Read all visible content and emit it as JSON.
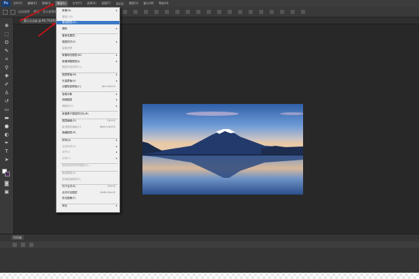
{
  "app": {
    "logo_text": "Ps"
  },
  "menubar": {
    "items": [
      "文件(F)",
      "编辑(E)",
      "图像(I)",
      "图层(L)",
      "文字(Y)",
      "选择(S)",
      "滤镜(T)",
      "3D(D)",
      "视图(V)",
      "窗口(W)",
      "帮助(H)"
    ],
    "active_index": 3
  },
  "options_bar": {
    "label_1": "自动选择:",
    "label_2": "图层",
    "label_3": "显示变换控件"
  },
  "document": {
    "tab_label": "富士山.jpg @ 66.7%(RGB/8#)"
  },
  "dropdown": {
    "items": [
      {
        "label": "新建(N)",
        "arrow": true
      },
      {
        "label": "复制 CSS",
        "disabled": true
      },
      {
        "label": "复制图层(D)...",
        "highlight": true
      },
      {
        "label": "删除",
        "arrow": true
      },
      {
        "label": "重命名图层..."
      },
      {
        "label": "图层样式(Y)",
        "arrow": true
      },
      {
        "label": "智能滤镜",
        "disabled": true
      },
      {
        "label": "新建填充图层(W)",
        "arrow": true
      },
      {
        "label": "新建调整图层(J)",
        "arrow": true
      },
      {
        "label": "图层内容选项(O)...",
        "disabled": true
      },
      {
        "label": "图层蒙版(M)",
        "arrow": true
      },
      {
        "label": "矢量蒙版(V)",
        "arrow": true
      },
      {
        "label": "创建剪贴蒙版(C)",
        "shortcut": "Alt+Ctrl+G"
      },
      {
        "label": "智能对象",
        "arrow": true
      },
      {
        "label": "视频图层",
        "arrow": true
      },
      {
        "label": "栅格化(Z)",
        "arrow": true,
        "disabled": true
      },
      {
        "label": "新建基于图层的切片(B)"
      },
      {
        "label": "图层编组(G)",
        "shortcut": "Ctrl+G"
      },
      {
        "label": "取消图层编组(U)",
        "shortcut": "Shift+Ctrl+G",
        "disabled": true
      },
      {
        "label": "隐藏图层(R)"
      },
      {
        "label": "排列(A)",
        "arrow": true
      },
      {
        "label": "合并形状(H)",
        "arrow": true,
        "disabled": true
      },
      {
        "label": "对齐(I)",
        "arrow": true,
        "disabled": true
      },
      {
        "label": "分布(T)",
        "arrow": true,
        "disabled": true
      },
      {
        "label": "锁定组内的所有图层(X)...",
        "disabled": true
      },
      {
        "label": "链接图层(K)",
        "disabled": true
      },
      {
        "label": "选择链接图层(S)",
        "disabled": true
      },
      {
        "label": "向下合并(E)",
        "shortcut": "Ctrl+E"
      },
      {
        "label": "合并可见图层",
        "shortcut": "Shift+Ctrl+E"
      },
      {
        "label": "拼合图像(F)"
      },
      {
        "label": "修边",
        "arrow": true
      }
    ]
  },
  "bottom_panel": {
    "tab_label": "时间轴"
  },
  "colors": {
    "menu_highlight": "#3a78c8",
    "annotation_arrow": "#c0161a",
    "app_background": "#2b2b2b"
  },
  "icons": [
    "move-tool-icon",
    "marquee-tool-icon",
    "lasso-tool-icon",
    "quick-select-tool-icon",
    "crop-tool-icon",
    "eyedropper-tool-icon",
    "healing-brush-icon",
    "brush-tool-icon",
    "clone-stamp-icon",
    "history-brush-icon",
    "eraser-tool-icon",
    "gradient-tool-icon",
    "blur-tool-icon",
    "dodge-tool-icon",
    "pen-tool-icon",
    "type-tool-icon",
    "path-select-icon",
    "shape-tool-icon",
    "hand-tool-icon",
    "zoom-tool-icon"
  ]
}
